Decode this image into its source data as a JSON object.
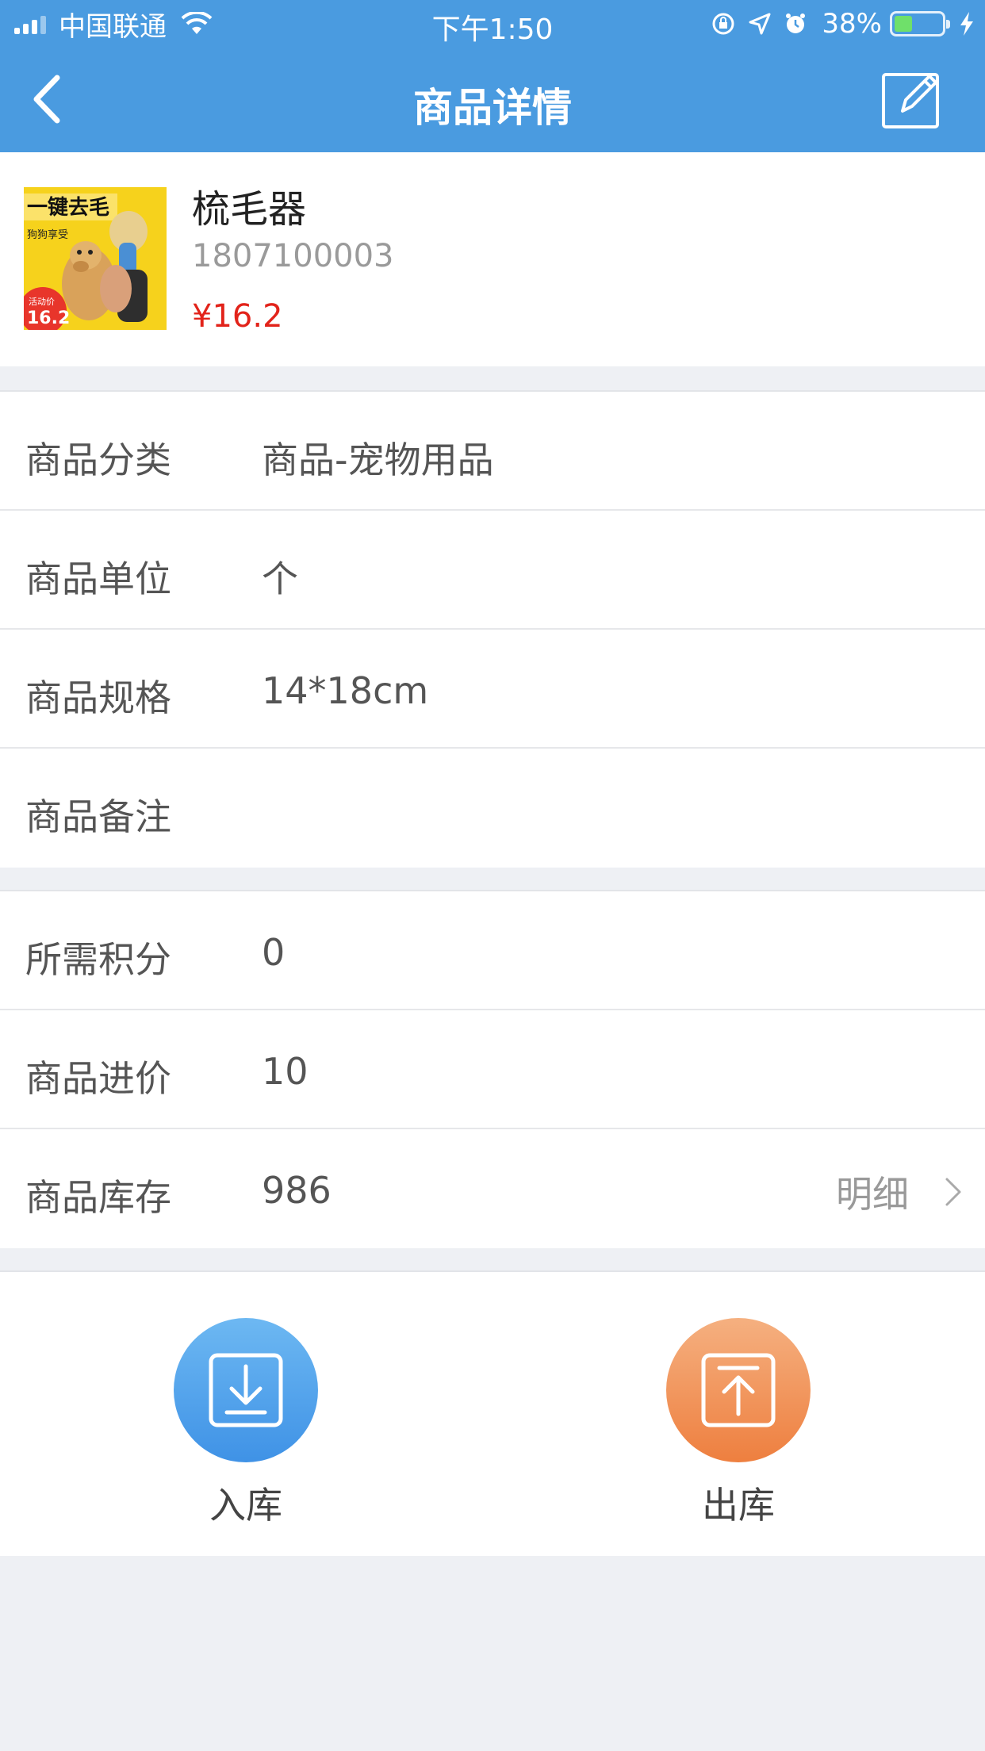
{
  "status_bar": {
    "carrier": "中国联通",
    "time": "下午1:50",
    "battery_percent": "38%"
  },
  "nav": {
    "title": "商品详情",
    "back_icon": "chevron-left-icon",
    "edit_icon": "edit-icon"
  },
  "product": {
    "name": "梳毛器",
    "code": "1807100003",
    "price": "¥16.2",
    "image_text": {
      "headline": "一键去毛",
      "tagline": "狗狗享受",
      "badge_label": "活动价",
      "badge_price": "16.2"
    }
  },
  "group1": [
    {
      "label": "商品分类",
      "value": "商品-宠物用品"
    },
    {
      "label": "商品单位",
      "value": "个"
    },
    {
      "label": "商品规格",
      "value": "14*18cm"
    },
    {
      "label": "商品备注",
      "value": ""
    }
  ],
  "group2": [
    {
      "label": "所需积分",
      "value": "0"
    },
    {
      "label": "商品进价",
      "value": "10"
    },
    {
      "label": "商品库存",
      "value": "986",
      "link": "明细"
    }
  ],
  "actions": {
    "stock_in": "入库",
    "stock_out": "出库"
  },
  "colors": {
    "header": "#4a9be0",
    "price": "#e2231a",
    "stock_in": "#4a9be0",
    "stock_out": "#ee7f3f"
  }
}
